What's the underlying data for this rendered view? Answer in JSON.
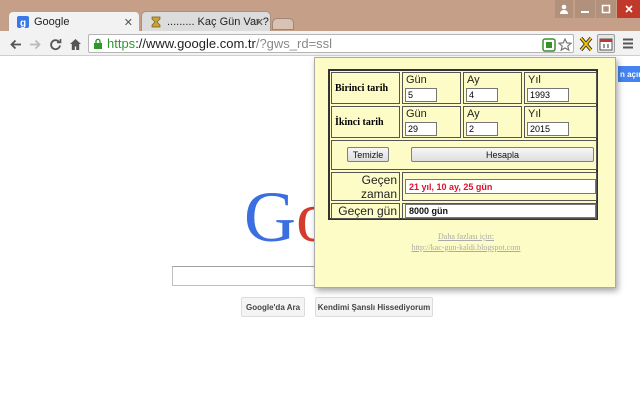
{
  "browser": {
    "tabs": [
      {
        "label": "Google",
        "active": true
      },
      {
        "label": "......... Kaç Gün Var ?",
        "active": false
      }
    ],
    "close_glyph": "✕",
    "address": {
      "https": "https",
      "host": "://www.google.com.tr",
      "path": "/?gws_rd=ssl"
    }
  },
  "google": {
    "logo_visible": "Goo",
    "search_button": "Google'da Ara",
    "lucky_button": "Kendimi Şanslı Hissediyorum",
    "signin_partial": "n açın"
  },
  "calculator": {
    "first_date_label": "Birinci tarih",
    "second_date_label": "İkinci tarih",
    "day_header": "Gün",
    "month_header": "Ay",
    "year_header": "Yıl",
    "first_date": {
      "day": "5",
      "month": "4",
      "year": "1993"
    },
    "second_date": {
      "day": "29",
      "month": "2",
      "year": "2015"
    },
    "clear_button": "Temizle",
    "calculate_button": "Hesapla",
    "elapsed_time_label_1": "Geçen",
    "elapsed_time_label_2": "zaman",
    "elapsed_time_value": "21 yıl,  10 ay,  25 gün",
    "elapsed_days_label": "Geçen gün",
    "elapsed_days_value": "8000 gün",
    "more_info_1": "Daha fazlası için:",
    "more_info_2": "http://kac-gun-kaldi.blogspot.com"
  },
  "colors": {
    "popup_bg": "#fdfcc6",
    "result_red": "#e0102a",
    "secure_green": "#2b9a2b"
  }
}
